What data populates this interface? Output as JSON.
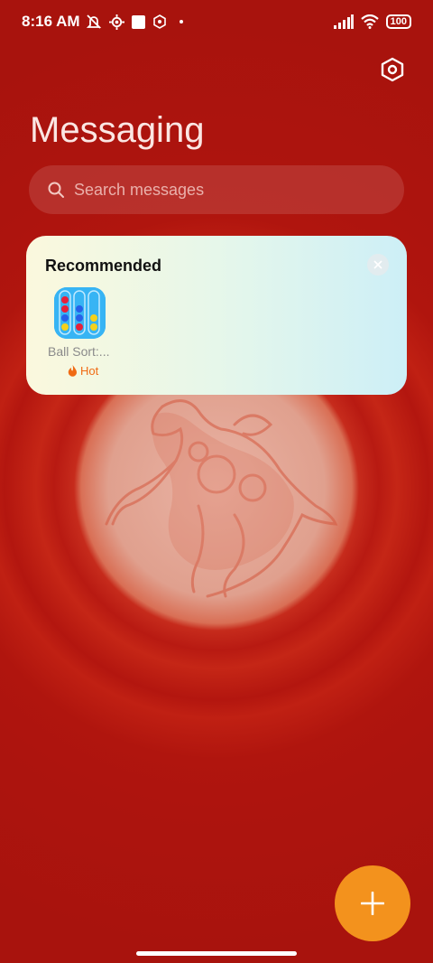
{
  "status_bar": {
    "time": "8:16 AM",
    "battery": "100",
    "icons": [
      "mute-icon",
      "gear-status-icon",
      "square-icon",
      "app-status-icon",
      "dot-icon",
      "signal-icon",
      "wifi-icon"
    ]
  },
  "header": {
    "title": "Messaging",
    "settings_icon": "settings-hexagon-icon"
  },
  "search": {
    "placeholder": "Search messages",
    "icon": "search-icon"
  },
  "recommended": {
    "title": "Recommended",
    "close_icon": "close-icon",
    "apps": [
      {
        "name": "Ball Sort:...",
        "badge": "Hot",
        "badge_icon": "fire-icon"
      }
    ]
  },
  "fab": {
    "icon": "plus-icon"
  },
  "colors": {
    "background": "#b3140f",
    "fab": "#f3921d",
    "hot": "#f06b14"
  }
}
